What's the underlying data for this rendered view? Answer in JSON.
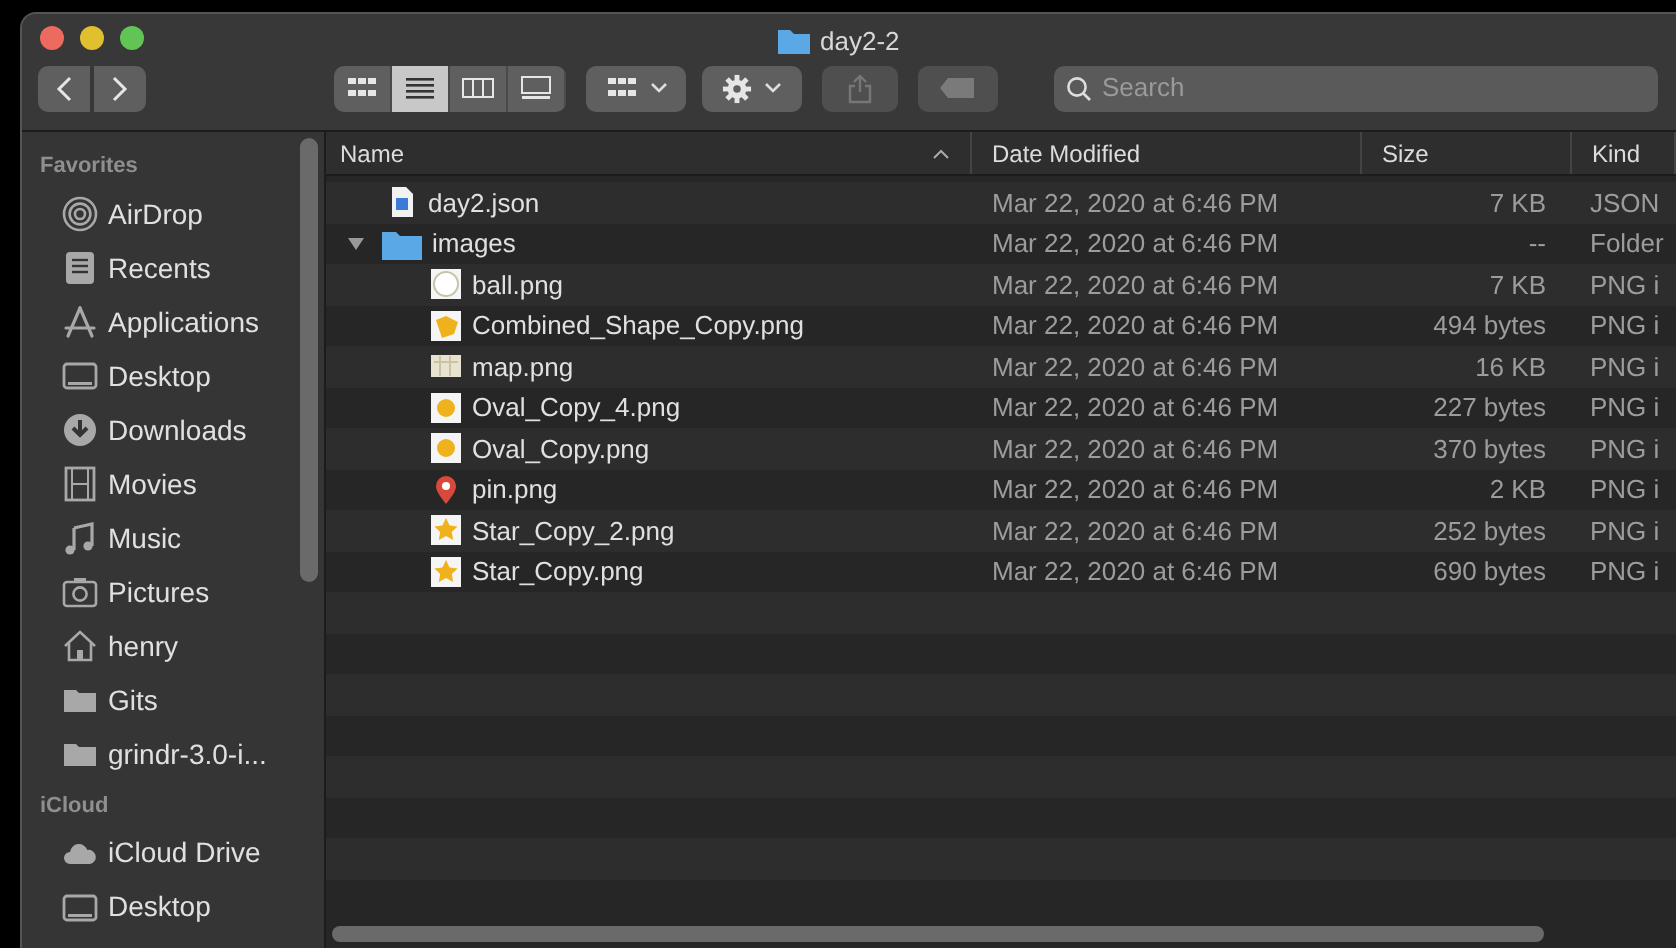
{
  "window": {
    "title": "day2-2"
  },
  "toolbar": {
    "view_modes": [
      {
        "kind": "icons",
        "selected": false
      },
      {
        "kind": "list",
        "selected": true
      },
      {
        "kind": "columns",
        "selected": false
      },
      {
        "kind": "gallery",
        "selected": false
      }
    ],
    "search": {
      "placeholder": "Search"
    }
  },
  "sidebar": {
    "sections": [
      {
        "heading": "Favorites",
        "items": [
          {
            "label": "AirDrop",
            "kind": "airdrop"
          },
          {
            "label": "Recents",
            "kind": "recents"
          },
          {
            "label": "Applications",
            "kind": "apps"
          },
          {
            "label": "Desktop",
            "kind": "desktop"
          },
          {
            "label": "Downloads",
            "kind": "downloads"
          },
          {
            "label": "Movies",
            "kind": "movies"
          },
          {
            "label": "Music",
            "kind": "music"
          },
          {
            "label": "Pictures",
            "kind": "pictures"
          },
          {
            "label": "henry",
            "kind": "home"
          },
          {
            "label": "Gits",
            "kind": "folder"
          },
          {
            "label": "grindr-3.0-i...",
            "kind": "folder"
          }
        ]
      },
      {
        "heading": "iCloud",
        "items": [
          {
            "label": "iCloud Drive",
            "kind": "cloud"
          },
          {
            "label": "Desktop",
            "kind": "desktop"
          }
        ]
      }
    ]
  },
  "table": {
    "columns": [
      {
        "label": "Name",
        "sorted": true
      },
      {
        "label": "Date Modified",
        "sorted": false
      },
      {
        "label": "Size",
        "sorted": false
      },
      {
        "label": "Kind",
        "sorted": false
      }
    ],
    "rows": [
      {
        "name": "day2.json",
        "date": "Mar 22, 2020 at 6:46 PM",
        "size": "7 KB",
        "kind_text": "JSON",
        "kind": "json"
      },
      {
        "name": "images",
        "date": "Mar 22, 2020 at 6:46 PM",
        "size": "--",
        "kind_text": "Folder",
        "kind": "folder",
        "expanded": true,
        "children": [
          {
            "name": "ball.png",
            "date": "Mar 22, 2020 at 6:46 PM",
            "size": "7 KB",
            "kind_text": "PNG i",
            "kind": "ball"
          },
          {
            "name": "Combined_Shape_Copy.png",
            "date": "Mar 22, 2020 at 6:46 PM",
            "size": "494 bytes",
            "kind_text": "PNG i",
            "kind": "shape"
          },
          {
            "name": "map.png",
            "date": "Mar 22, 2020 at 6:46 PM",
            "size": "16 KB",
            "kind_text": "PNG i",
            "kind": "map"
          },
          {
            "name": "Oval_Copy_4.png",
            "date": "Mar 22, 2020 at 6:46 PM",
            "size": "227 bytes",
            "kind_text": "PNG i",
            "kind": "oval"
          },
          {
            "name": "Oval_Copy.png",
            "date": "Mar 22, 2020 at 6:46 PM",
            "size": "370 bytes",
            "kind_text": "PNG i",
            "kind": "oval"
          },
          {
            "name": "pin.png",
            "date": "Mar 22, 2020 at 6:46 PM",
            "size": "2 KB",
            "kind_text": "PNG i",
            "kind": "pin"
          },
          {
            "name": "Star_Copy_2.png",
            "date": "Mar 22, 2020 at 6:46 PM",
            "size": "252 bytes",
            "kind_text": "PNG i",
            "kind": "star"
          },
          {
            "name": "Star_Copy.png",
            "date": "Mar 22, 2020 at 6:46 PM",
            "size": "690 bytes",
            "kind_text": "PNG i",
            "kind": "star"
          }
        ]
      }
    ]
  }
}
